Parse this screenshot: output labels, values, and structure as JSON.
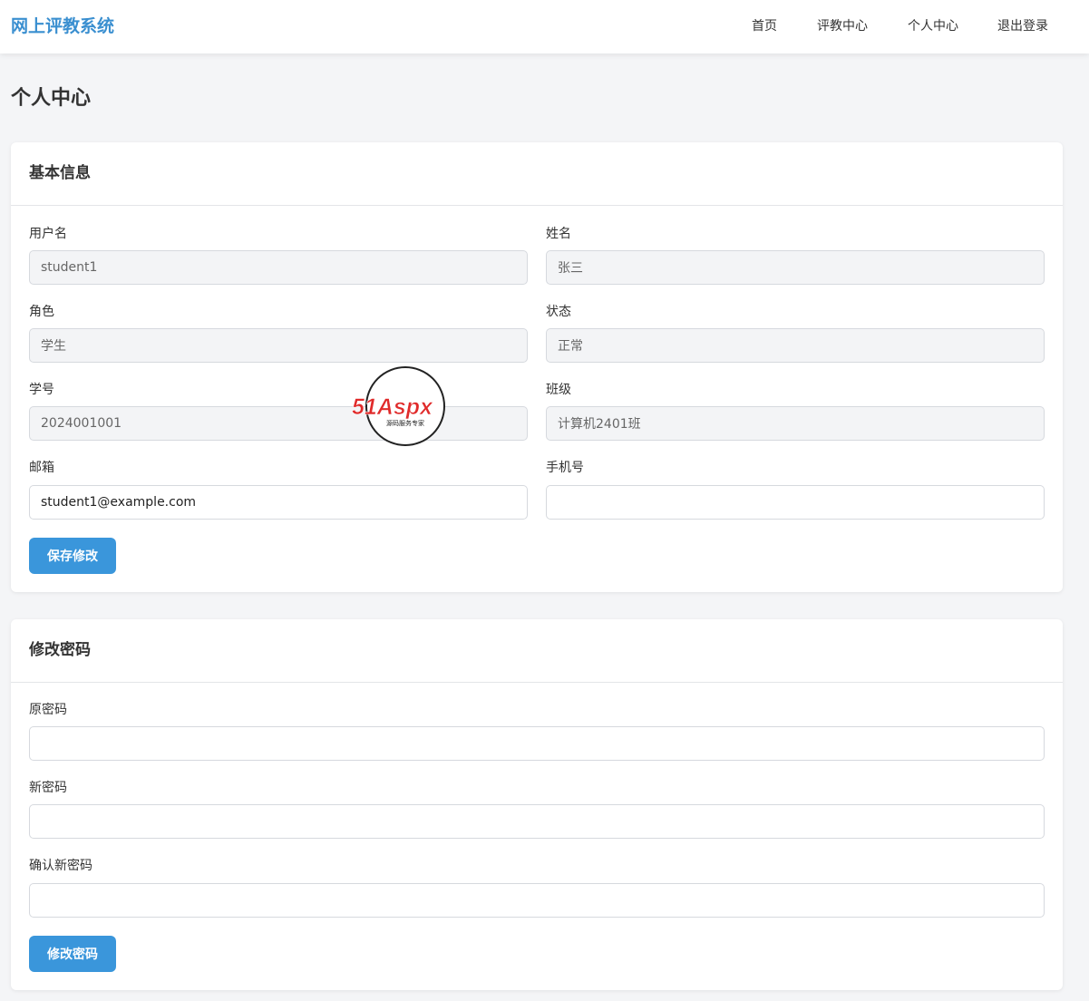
{
  "navbar": {
    "brand": "网上评教系统",
    "links": [
      "首页",
      "评教中心",
      "个人中心",
      "退出登录"
    ]
  },
  "page_title": "个人中心",
  "basic_info": {
    "title": "基本信息",
    "username_label": "用户名",
    "username_value": "student1",
    "name_label": "姓名",
    "name_value": "张三",
    "role_label": "角色",
    "role_value": "学生",
    "status_label": "状态",
    "status_value": "正常",
    "student_no_label": "学号",
    "student_no_value": "2024001001",
    "class_label": "班级",
    "class_value": "计算机2401班",
    "email_label": "邮箱",
    "email_value": "student1@example.com",
    "phone_label": "手机号",
    "phone_value": "",
    "save_button": "保存修改"
  },
  "password": {
    "title": "修改密码",
    "old_label": "原密码",
    "new_label": "新密码",
    "confirm_label": "确认新密码",
    "submit_button": "修改密码"
  },
  "watermark": {
    "logo_text": "51Aspx",
    "tagline": "源码服务专家"
  },
  "colors": {
    "brand": "#3a8fd0",
    "button": "#3a96db",
    "watermark_red": "#e02a2a",
    "watermark_green": "#2ea44f"
  }
}
